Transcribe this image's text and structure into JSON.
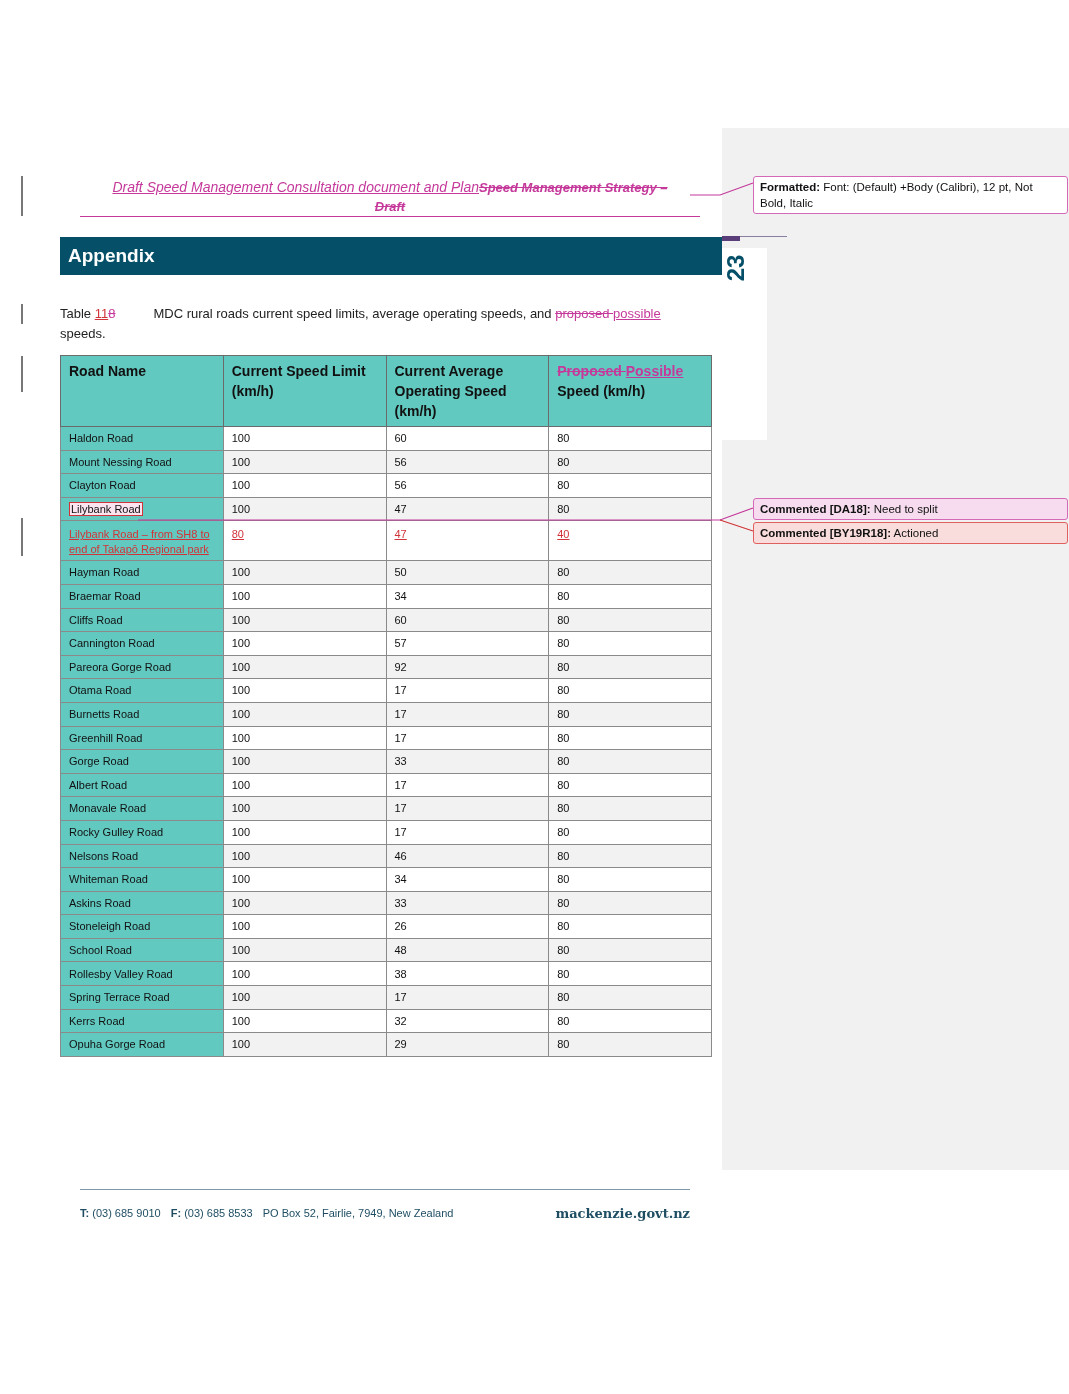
{
  "header": [
    {
      "kind": "inserted",
      "text": "Draft Speed Management Consultation document and Plan"
    },
    {
      "kind": "deleted",
      "text": "Speed Management Strategy – Draft"
    }
  ],
  "section_title": "Appendix",
  "page_number": "23",
  "caption": [
    {
      "kind": "normal",
      "text": "Table "
    },
    {
      "kind": "inserted",
      "text": "11"
    },
    {
      "kind": "deleted",
      "text": "8"
    },
    {
      "kind": "tab",
      "text": "MDC rural roads current speed limits, average operating speeds, and "
    },
    {
      "kind": "deleted",
      "text": "proposed "
    },
    {
      "kind": "inserted",
      "text": "possible"
    },
    {
      "kind": "normal",
      "text": " speeds."
    }
  ],
  "table": {
    "columns": [
      {
        "text": "Road Name"
      },
      {
        "text": "Current Speed Limit (km/h)"
      },
      {
        "text": "Current Average Operating Speed (km/h)"
      },
      {
        "deleted": "Proposed ",
        "inserted": "Possible",
        "text": " Speed (km/h)"
      }
    ],
    "rows": [
      {
        "inserted": false,
        "commented": false,
        "cells": [
          "Haldon Road",
          "100",
          "60",
          "80"
        ]
      },
      {
        "inserted": false,
        "commented": false,
        "cells": [
          "Mount Nessing Road",
          "100",
          "56",
          "80"
        ]
      },
      {
        "inserted": false,
        "commented": false,
        "cells": [
          "Clayton Road",
          "100",
          "56",
          "80"
        ]
      },
      {
        "inserted": false,
        "commented": true,
        "cells": [
          "Lilybank Road",
          "100",
          "47",
          "80"
        ]
      },
      {
        "inserted": true,
        "commented": false,
        "cells": [
          "Lilybank Road – from SH8 to end of Takapō Regional park",
          "80",
          "47",
          "40"
        ]
      },
      {
        "inserted": false,
        "commented": false,
        "cells": [
          "Hayman Road",
          "100",
          "50",
          "80"
        ]
      },
      {
        "inserted": false,
        "commented": false,
        "cells": [
          "Braemar Road",
          "100",
          "34",
          "80"
        ]
      },
      {
        "inserted": false,
        "commented": false,
        "cells": [
          "Cliffs Road",
          "100",
          "60",
          "80"
        ]
      },
      {
        "inserted": false,
        "commented": false,
        "cells": [
          "Cannington Road",
          "100",
          "57",
          "80"
        ]
      },
      {
        "inserted": false,
        "commented": false,
        "cells": [
          "Pareora Gorge Road",
          "100",
          "92",
          "80"
        ]
      },
      {
        "inserted": false,
        "commented": false,
        "cells": [
          "Otama Road",
          "100",
          "17",
          "80"
        ]
      },
      {
        "inserted": false,
        "commented": false,
        "cells": [
          "Burnetts Road",
          "100",
          "17",
          "80"
        ]
      },
      {
        "inserted": false,
        "commented": false,
        "cells": [
          "Greenhill Road",
          "100",
          "17",
          "80"
        ]
      },
      {
        "inserted": false,
        "commented": false,
        "cells": [
          "Gorge Road",
          "100",
          "33",
          "80"
        ]
      },
      {
        "inserted": false,
        "commented": false,
        "cells": [
          "Albert Road",
          "100",
          "17",
          "80"
        ]
      },
      {
        "inserted": false,
        "commented": false,
        "cells": [
          "Monavale Road",
          "100",
          "17",
          "80"
        ]
      },
      {
        "inserted": false,
        "commented": false,
        "cells": [
          "Rocky Gulley Road",
          "100",
          "17",
          "80"
        ]
      },
      {
        "inserted": false,
        "commented": false,
        "cells": [
          "Nelsons Road",
          "100",
          "46",
          "80"
        ]
      },
      {
        "inserted": false,
        "commented": false,
        "cells": [
          "Whiteman Road",
          "100",
          "34",
          "80"
        ]
      },
      {
        "inserted": false,
        "commented": false,
        "cells": [
          "Askins Road",
          "100",
          "33",
          "80"
        ]
      },
      {
        "inserted": false,
        "commented": false,
        "cells": [
          "Stoneleigh Road",
          "100",
          "26",
          "80"
        ]
      },
      {
        "inserted": false,
        "commented": false,
        "cells": [
          "School Road",
          "100",
          "48",
          "80"
        ]
      },
      {
        "inserted": false,
        "commented": false,
        "cells": [
          "Rollesby Valley Road",
          "100",
          "38",
          "80"
        ]
      },
      {
        "inserted": false,
        "commented": false,
        "cells": [
          "Spring Terrace Road",
          "100",
          "17",
          "80"
        ]
      },
      {
        "inserted": false,
        "commented": false,
        "cells": [
          "Kerrs Road",
          "100",
          "32",
          "80"
        ]
      },
      {
        "inserted": false,
        "commented": false,
        "cells": [
          "Opuha Gorge Road",
          "100",
          "29",
          "80"
        ]
      }
    ]
  },
  "footer": {
    "contact": [
      {
        "label": "T:",
        "value": "(03) 685 9010"
      },
      {
        "label": "F:",
        "value": "(03) 685 8533"
      },
      {
        "value": "PO Box 52, Fairlie, 7949, New Zealand"
      }
    ],
    "website": "mackenzie.govt.nz"
  },
  "balloons": [
    {
      "kind": "formatting",
      "color": "#ffffff",
      "label": "Formatted:",
      "text": "Font: (Default) +Body (Calibri), 12 pt, Not Bold, Italic"
    },
    {
      "kind": "comment",
      "color": "#f6dcee",
      "label": "Commented [DA18]:",
      "text": "Need to split"
    },
    {
      "kind": "comment",
      "color": "#f9dcdc",
      "label": "Commented [BY19R18]:",
      "text": "Actioned"
    }
  ]
}
